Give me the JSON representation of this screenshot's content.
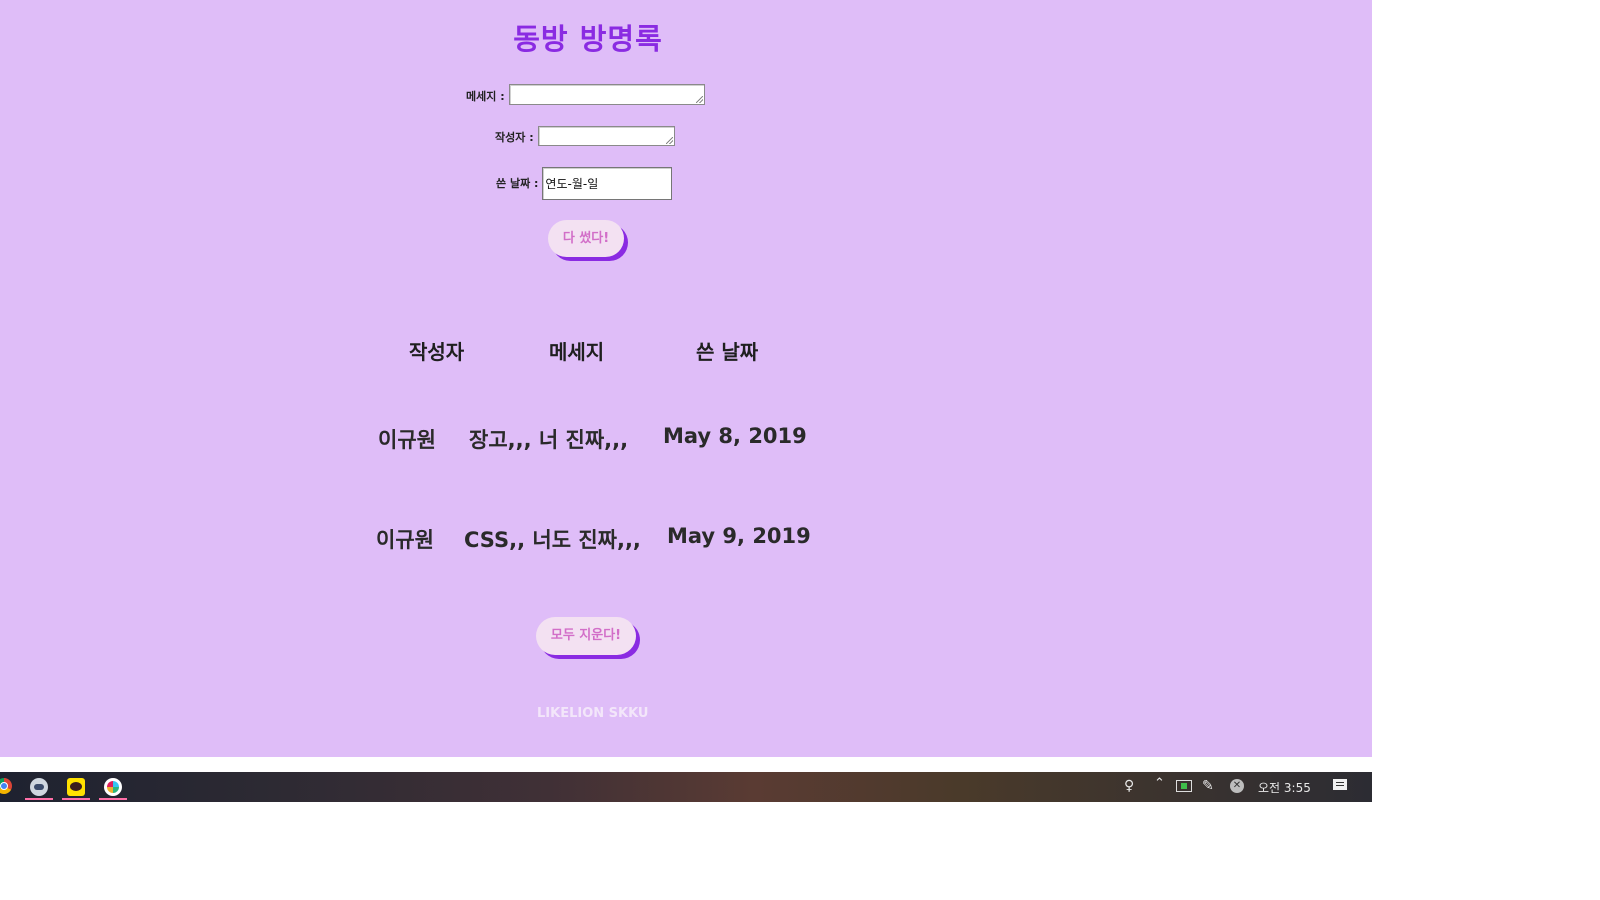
{
  "page": {
    "title": "동방 방명록",
    "background": "#dfbdf8",
    "accent": "#8a2be2"
  },
  "form": {
    "message_label": "메세지 :",
    "message_value": "",
    "author_label": "작성자 :",
    "author_value": "",
    "date_label": "쓴 날짜 :",
    "date_value": "연도-월-일",
    "submit_label": "다 썼다!"
  },
  "table": {
    "headers": [
      "작성자",
      "메세지",
      "쓴 날짜"
    ],
    "rows": [
      {
        "author": "이규원",
        "message": "장고,,, 너 진짜,,,",
        "date": "May 8, 2019"
      },
      {
        "author": "이규원",
        "message": "CSS,, 너도 진짜,,,",
        "date": "May 9, 2019"
      }
    ]
  },
  "clear_button_label": "모두 지운다!",
  "footer": "LIKELION SKKU",
  "taskbar": {
    "apps": [
      "chrome-icon",
      "app-icon",
      "kakaotalk-icon",
      "slack-icon"
    ],
    "clock": "오전 3:55",
    "tray_icons": [
      "people-icon",
      "chevron-up-icon",
      "battery-icon",
      "pen-icon",
      "close-circle-icon",
      "notification-icon"
    ]
  }
}
